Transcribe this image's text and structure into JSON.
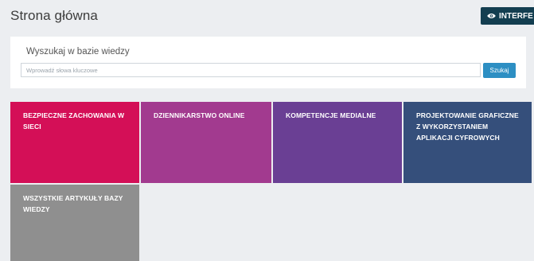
{
  "header": {
    "title": "Strona główna",
    "interface_button_label": "INTERFE"
  },
  "search": {
    "label": "Wyszukaj w bazie wiedzy",
    "placeholder": "Wprowadź słowa kluczowe",
    "value": "",
    "button_label": "Szukaj"
  },
  "tiles": [
    {
      "label": "BEZPIECZNE ZACHOWANIA W SIECI",
      "color": "#d40f57"
    },
    {
      "label": "DZIENNIKARSTWO ONLINE",
      "color": "#a23a8f"
    },
    {
      "label": "KOMPETENCJE MEDIALNE",
      "color": "#6a3f94"
    },
    {
      "label": "PROJEKTOWANIE GRAFICZNE Z WYKORZYSTANIEM APLIKACJI CYFROWYCH",
      "color": "#354f7b"
    },
    {
      "label": "WSZYSTKIE ARTYKUŁY BAZY WIEDZY",
      "color": "#8f8f8f"
    }
  ],
  "colors": {
    "background": "#eceef1",
    "panel": "#ffffff",
    "accent_button": "#133e50",
    "search_button": "#2d8fc3"
  },
  "icons": {
    "interface_button": "eye-icon"
  }
}
